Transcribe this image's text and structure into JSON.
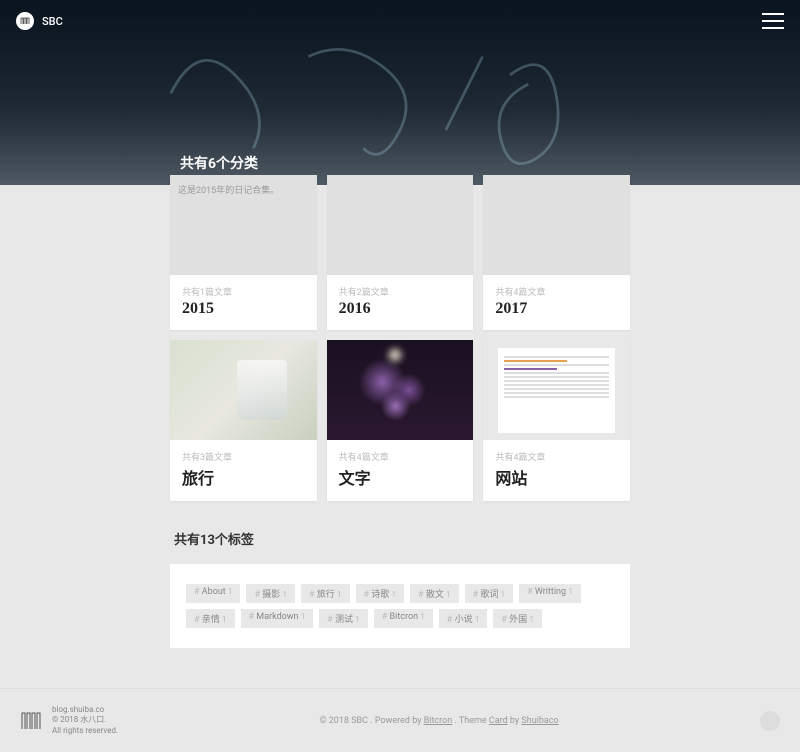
{
  "site": {
    "name": "SBC"
  },
  "hero": {
    "title": "共有6个分类"
  },
  "categories": [
    {
      "title": "2015",
      "count_text": "共有1篇文章",
      "description": "这是2015年的日记合集。",
      "image_type": "none"
    },
    {
      "title": "2016",
      "count_text": "共有2篇文章",
      "description": "",
      "image_type": "none"
    },
    {
      "title": "2017",
      "count_text": "共有4篇文章",
      "description": "",
      "image_type": "none"
    },
    {
      "title": "旅行",
      "count_text": "共有3篇文章",
      "description": "",
      "image_type": "glass"
    },
    {
      "title": "文字",
      "count_text": "共有4篇文章",
      "description": "",
      "image_type": "flowers"
    },
    {
      "title": "网站",
      "count_text": "共有4篇文章",
      "description": "",
      "image_type": "doc"
    }
  ],
  "tags": {
    "header": "共有13个标签",
    "items": [
      {
        "name": "About",
        "count": "1"
      },
      {
        "name": "摄影",
        "count": "1"
      },
      {
        "name": "旅行",
        "count": "1"
      },
      {
        "name": "诗歌",
        "count": "1"
      },
      {
        "name": "散文",
        "count": "1"
      },
      {
        "name": "歌词",
        "count": "1"
      },
      {
        "name": "Writting",
        "count": "1"
      },
      {
        "name": "亲情",
        "count": "1"
      },
      {
        "name": "Markdown",
        "count": "1"
      },
      {
        "name": "测试",
        "count": "1"
      },
      {
        "name": "Bitcron",
        "count": "1"
      },
      {
        "name": "小说",
        "count": "1"
      },
      {
        "name": "外国",
        "count": "1"
      }
    ]
  },
  "footer": {
    "domain": "blog.shuiba.co",
    "copyright": "© 2018 水八口.",
    "rights": "All rights reserved.",
    "center_prefix": "© 2018 SBC . Powered by ",
    "powered_by": "Bitcron",
    "theme_prefix": " . Theme ",
    "theme_name": "Card",
    "theme_by": " by ",
    "theme_author": "Shuibaco"
  }
}
